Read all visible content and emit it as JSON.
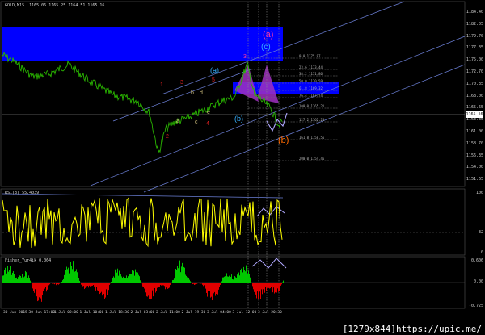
{
  "header": {
    "symbol_label": "GOLD,M15",
    "ohlc": "1165.06  1165.25  1164.51  1165.16"
  },
  "price_axis": {
    "ticks": [
      "1184.40",
      "1182.05",
      "1179.70",
      "1177.35",
      "1175.00",
      "1172.70",
      "1170.35",
      "1168.00",
      "1165.65",
      "1163.35",
      "1161.00",
      "1158.70",
      "1156.35",
      "1154.00",
      "1151.65"
    ],
    "current_price": "1165.16"
  },
  "fib_levels": [
    {
      "label": "0.0",
      "price": "1175.97"
    },
    {
      "label": "23.6",
      "price": "1173.44"
    },
    {
      "label": "38.2",
      "price": "1171.86"
    },
    {
      "label": "50.0",
      "price": "1170.59"
    },
    {
      "label": "61.8",
      "price": "1169.32"
    },
    {
      "label": "76.4",
      "price": "1167.74"
    },
    {
      "label": "100.0",
      "price": "1165.21"
    },
    {
      "label": "127.2",
      "price": "1162.28"
    },
    {
      "label": "161.8",
      "price": "1158.56"
    },
    {
      "label": "200.0",
      "price": "1154.46"
    }
  ],
  "wave_labels": {
    "a_circled": "(a)",
    "b_circled": "(b)",
    "c_circled": "(c)",
    "paren_a": "(a)",
    "paren_b": "(b)",
    "paren_c": "(c)",
    "n1": "1",
    "n2": "2",
    "n3": "3",
    "n4": "4",
    "n5": "5",
    "sa": "a",
    "sb": "b",
    "sc": "c",
    "sd": "d",
    "se": "e"
  },
  "rsi": {
    "label": "RSI(3) 55.4039",
    "ticks": [
      "100",
      "32",
      "0"
    ]
  },
  "fisher": {
    "label": "Fisher_Yur4ik 0.064",
    "ticks": [
      "0.606",
      "0.00",
      "-0.725"
    ]
  },
  "time_axis": [
    "30 Jun 2015",
    "30 Jun 17:00",
    "1 Jul 02:00",
    "1 Jul 10:00",
    "1 Jul 18:30",
    "2 Jul 03:00",
    "2 Jul 11:00",
    "2 Jul 19:30",
    "3 Jul 04:00",
    "3 Jul 12:00",
    "3 Jul 20:30"
  ],
  "watermark": "[1279x844]https://upic.me/",
  "colors": {
    "price_line": "#29b400",
    "rsi_line": "#ffff00",
    "fisher_pos": "#00c800",
    "fisher_neg": "#e00000",
    "zone": "#0000ff",
    "magenta": "#a030c0",
    "channel": "#6b7fd6"
  }
}
